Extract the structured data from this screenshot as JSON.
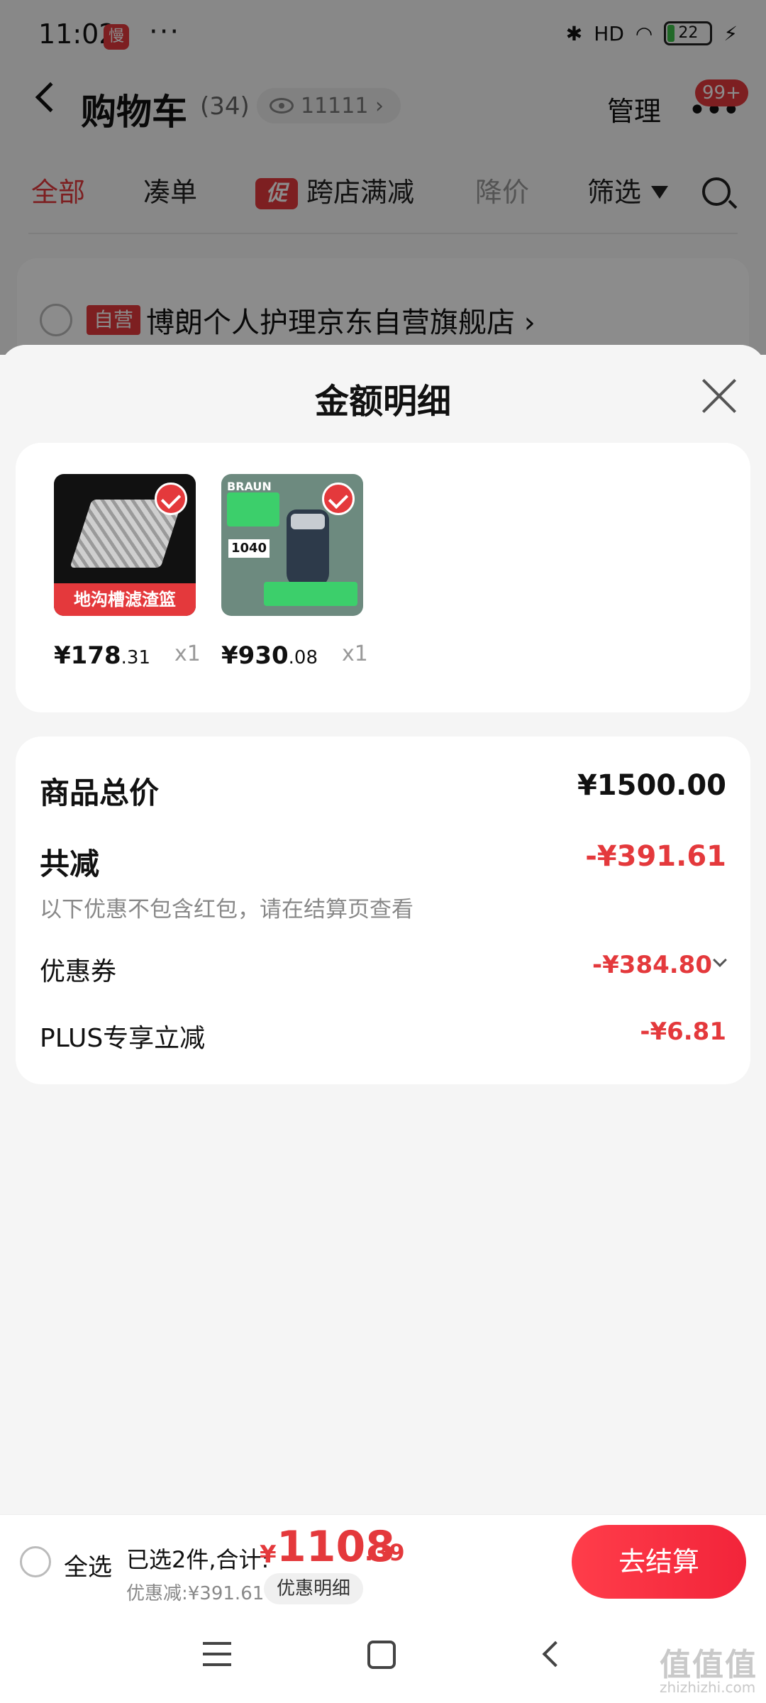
{
  "status_bar": {
    "time": "11:02",
    "app_icon_text": "慢",
    "dots": "···",
    "signal": "HD",
    "battery": "22"
  },
  "header": {
    "title": "购物车",
    "count": "(34)",
    "views": "11111 ›",
    "manage": "管理",
    "more": "•••",
    "badge": "99+"
  },
  "tabs": {
    "all": "全部",
    "bundle": "凑单",
    "promo_tag": "促",
    "cross_store": "跨店满减",
    "price_drop": "降价",
    "filter": "筛选"
  },
  "store": {
    "tag": "自营",
    "name": "博朗个人护理京东自营旗舰店 ›"
  },
  "sheet": {
    "title": "金额明细",
    "items": [
      {
        "thumb_label": "地沟槽滤渣篮",
        "price_int": "¥178",
        "price_dec": ".31",
        "qty": "x1"
      },
      {
        "brand": "BRAUN",
        "thumb_price": "1040",
        "price_int": "¥930",
        "price_dec": ".08",
        "qty": "x1"
      }
    ],
    "summary": {
      "total_label": "商品总价",
      "total_value": "¥1500.00",
      "reduce_label": "共减",
      "reduce_value": "-¥391.61",
      "note": "以下优惠不包含红包，请在结算页查看",
      "coupon_label": "优惠券",
      "coupon_value": "-¥384.80",
      "plus_label": "PLUS专享立减",
      "plus_value": "-¥6.81"
    }
  },
  "checkout": {
    "select_all": "全选",
    "selected": "已选2件,合计:",
    "yen": "¥",
    "total_int": "1108",
    "total_dec": ".39",
    "discount": "优惠减:¥391.61",
    "detail_chip": "优惠明细",
    "button": "去结算"
  },
  "watermark": {
    "main": "值值值",
    "sub": "zhizhizhi.com"
  },
  "colors": {
    "accent": "#e4393c",
    "check_button_start": "#ff3d4a",
    "check_button_end": "#f2243a"
  }
}
